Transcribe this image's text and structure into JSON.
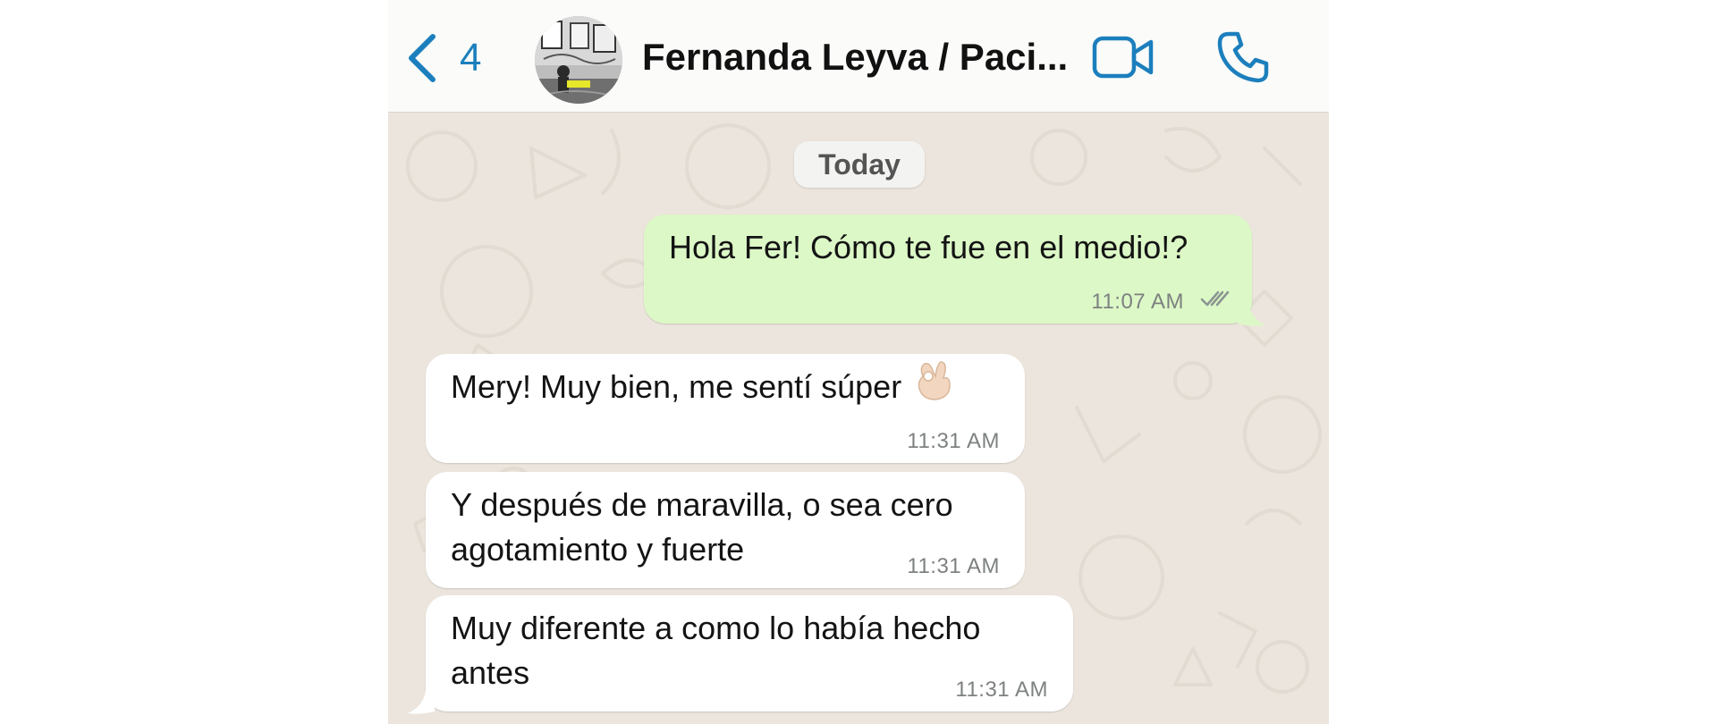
{
  "header": {
    "back_count": "4",
    "contact_name": "Fernanda Leyva / Paci...",
    "icons": {
      "back": "chevron-left-icon",
      "video": "video-camera-icon",
      "call": "phone-icon"
    },
    "accent_color": "#1c7fbd"
  },
  "chat": {
    "date_label": "Today",
    "messages": [
      {
        "direction": "outgoing",
        "text": "Hola Fer! Cómo te fue en el medio!?",
        "time": "11:07 AM",
        "status_icon": "double-check-icon"
      },
      {
        "direction": "incoming",
        "text": "Mery! Muy bien, me sentí súper",
        "emoji": "ok-hand-emoji-icon",
        "time": "11:31 AM"
      },
      {
        "direction": "incoming",
        "lines": [
          "Y después de maravilla, o sea cero",
          "agotamiento y fuerte"
        ],
        "time": "11:31 AM"
      },
      {
        "direction": "incoming",
        "lines": [
          "Muy diferente a como lo había hecho",
          "antes"
        ],
        "time": "11:31 AM"
      }
    ],
    "colors": {
      "outgoing_bubble": "#dcf8c6",
      "incoming_bubble": "#ffffff",
      "wallpaper": "#ece5dd"
    }
  }
}
